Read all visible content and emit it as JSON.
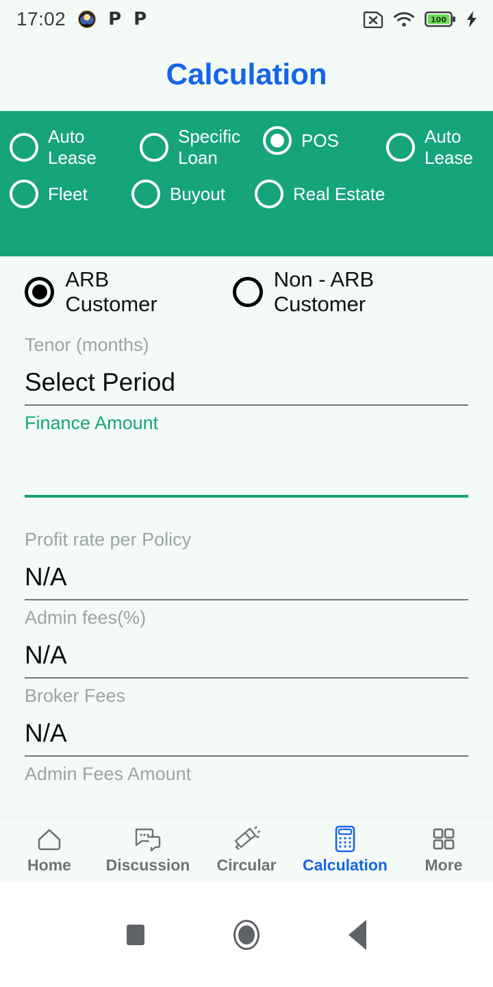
{
  "status_bar": {
    "time": "17:02",
    "left_icons": [
      "app-badge-icon",
      "p-notification-icon",
      "p-notification-icon"
    ],
    "p_glyph": "P",
    "right_icons": [
      "sim-card-disabled-icon",
      "wifi-icon",
      "battery-icon",
      "charging-bolt-icon"
    ],
    "battery_level": "100",
    "battery_color": "#6fdc5b"
  },
  "header": {
    "title": "Calculation",
    "title_color": "#1565e8"
  },
  "product_panel": {
    "background_color": "#16a47b",
    "row1": [
      {
        "label": "Auto\nLease",
        "checked": false
      },
      {
        "label": "Specific\nLoan",
        "checked": false
      },
      {
        "label": "POS",
        "checked": true
      },
      {
        "label": "Auto\nLease",
        "checked": false
      }
    ],
    "row2": [
      {
        "label": "Fleet",
        "checked": false
      },
      {
        "label": "Buyout",
        "checked": false
      },
      {
        "label": "Real Estate",
        "checked": false
      }
    ]
  },
  "customer_type": [
    {
      "label": "ARB Customer",
      "checked": true
    },
    {
      "label": "Non - ARB Customer",
      "checked": false
    }
  ],
  "form": {
    "fields": [
      {
        "label": "Tenor (months)",
        "value": "Select Period",
        "focused": false
      },
      {
        "label": "Finance Amount",
        "value": "",
        "focused": true
      },
      {
        "label": "Profit rate per Policy",
        "value": "N/A",
        "focused": false
      },
      {
        "label": "Admin fees(%)",
        "value": "N/A",
        "focused": false
      },
      {
        "label": "Broker Fees",
        "value": "N/A",
        "focused": false
      },
      {
        "label": "Admin Fees Amount",
        "value": "",
        "focused": false
      }
    ],
    "focus_color": "#16a47b"
  },
  "bottom_nav": {
    "active_color": "#1565e8",
    "items": [
      {
        "label": "Home",
        "icon": "home-icon",
        "active": false
      },
      {
        "label": "Discussion",
        "icon": "chat-bubbles-icon",
        "active": false
      },
      {
        "label": "Circular",
        "icon": "megaphone-icon",
        "active": false
      },
      {
        "label": "Calculation",
        "icon": "calculator-icon",
        "active": true
      },
      {
        "label": "More",
        "icon": "grid-icon",
        "active": false
      }
    ]
  },
  "system_bar": {
    "buttons": [
      "recents-square-icon",
      "home-circle-icon",
      "back-triangle-icon"
    ]
  }
}
